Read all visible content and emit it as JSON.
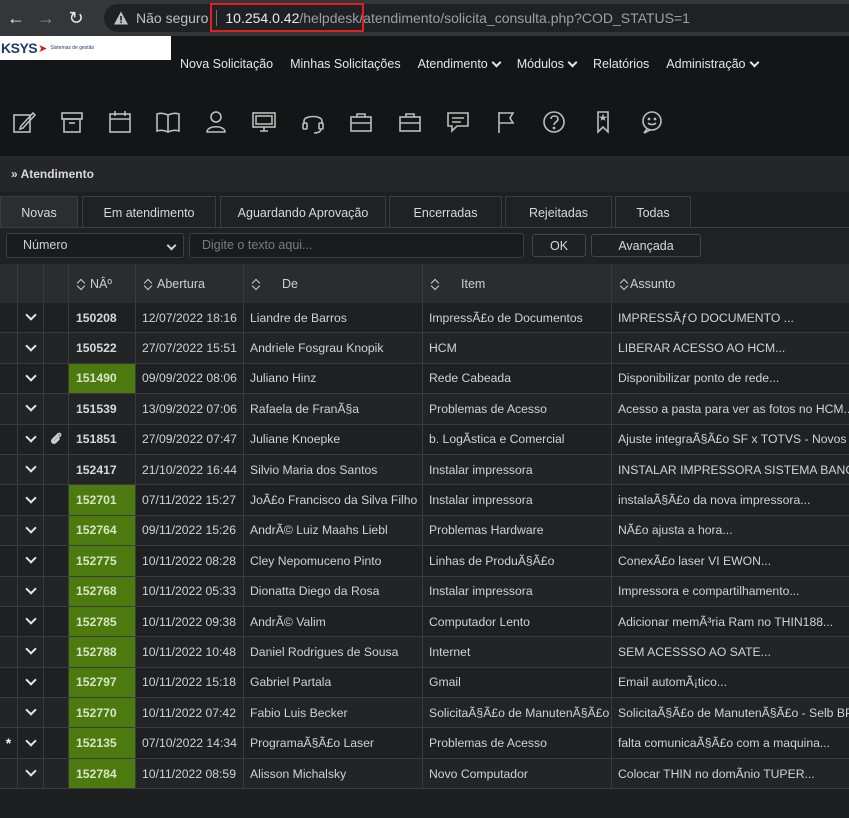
{
  "browser": {
    "not_secure": "Não seguro",
    "url_host": "10.254.0.42",
    "url_path": "/helpdesk/atendimento/solicita_consulta.php?COD_STATUS=1"
  },
  "logo": {
    "text": "KSYS",
    "tagline": "Sistemas de gestão"
  },
  "menu": {
    "items": [
      {
        "label": "Nova Solicitação",
        "dropdown": false
      },
      {
        "label": "Minhas Solicitações",
        "dropdown": false
      },
      {
        "label": "Atendimento",
        "dropdown": true
      },
      {
        "label": "Módulos",
        "dropdown": true
      },
      {
        "label": "Relatórios",
        "dropdown": false
      },
      {
        "label": "Administração",
        "dropdown": true
      }
    ]
  },
  "toolbar_icons": [
    "edit-icon",
    "archive-icon",
    "calendar-icon",
    "book-icon",
    "user-icon",
    "monitor-icon",
    "headset-icon",
    "briefcase-icon",
    "briefcase-icon",
    "chat-icon",
    "flag-icon",
    "help-icon",
    "bookmark-icon",
    "smile-chat-icon"
  ],
  "breadcrumb": "» Atendimento",
  "tabs": [
    {
      "label": "Novas",
      "active": true
    },
    {
      "label": "Em atendimento",
      "active": false
    },
    {
      "label": "Aguardando Aprovação",
      "active": false
    },
    {
      "label": "Encerradas",
      "active": false
    },
    {
      "label": "Rejeitadas",
      "active": false
    },
    {
      "label": "Todas",
      "active": false
    }
  ],
  "filters": {
    "field_select": "Número",
    "search_placeholder": "Digite o texto aqui...",
    "ok_label": "OK",
    "advanced_label": "Avançada"
  },
  "table": {
    "columns": [
      "NÂº",
      "Abertura",
      "De",
      "Item",
      "Assunto"
    ],
    "rows": [
      {
        "marker": "",
        "clip": false,
        "num": "150208",
        "green": false,
        "date": "12/07/2022 18:16",
        "from": "Liandre de Barros",
        "item": "ImpressÃ£o de Documentos",
        "subject": "IMPRESSÃƒO DOCUMENTO ..."
      },
      {
        "marker": "",
        "clip": false,
        "num": "150522",
        "green": false,
        "date": "27/07/2022 15:51",
        "from": "Andriele Fosgrau Knopik",
        "item": "HCM",
        "subject": "LIBERAR ACESSO AO HCM..."
      },
      {
        "marker": "",
        "clip": false,
        "num": "151490",
        "green": true,
        "date": "09/09/2022 08:06",
        "from": "Juliano Hinz",
        "item": "Rede Cabeada",
        "subject": "Disponibilizar ponto de rede..."
      },
      {
        "marker": "",
        "clip": false,
        "num": "151539",
        "green": false,
        "date": "13/09/2022 07:06",
        "from": "Rafaela de FranÃ§a",
        "item": "Problemas de Acesso",
        "subject": "Acesso a pasta para ver as fotos no HCM..."
      },
      {
        "marker": "",
        "clip": true,
        "num": "151851",
        "green": false,
        "date": "27/09/2022 07:47",
        "from": "Juliane Knoepke",
        "item": "b. LogÃ­stica e Comercial",
        "subject": "Ajuste integraÃ§Ã£o SF x TOTVS - Novos c"
      },
      {
        "marker": "",
        "clip": false,
        "num": "152417",
        "green": false,
        "date": "21/10/2022 16:44",
        "from": "Silvio Maria dos Santos",
        "item": "Instalar impressora",
        "subject": "INSTALAR IMPRESSORA SISTEMA BANCO"
      },
      {
        "marker": "",
        "clip": false,
        "num": "152701",
        "green": true,
        "date": "07/11/2022 15:27",
        "from": "JoÃ£o Francisco da Silva Filho",
        "item": "Instalar impressora",
        "subject": "instalaÃ§Ã£o da nova impressora..."
      },
      {
        "marker": "",
        "clip": false,
        "num": "152764",
        "green": true,
        "date": "09/11/2022 15:26",
        "from": "AndrÃ© Luiz Maahs Liebl",
        "item": "Problemas Hardware",
        "subject": "NÃ£o ajusta a hora..."
      },
      {
        "marker": "",
        "clip": false,
        "num": "152775",
        "green": true,
        "date": "10/11/2022 08:28",
        "from": "Cley Nepomuceno Pinto",
        "item": "Linhas de ProduÃ§Ã£o",
        "subject": "ConexÃ£o laser VI EWON..."
      },
      {
        "marker": "",
        "clip": false,
        "num": "152768",
        "green": true,
        "date": "10/11/2022 05:33",
        "from": "Dionatta Diego da Rosa",
        "item": "Instalar impressora",
        "subject": "Impressora e compartilhamento..."
      },
      {
        "marker": "",
        "clip": false,
        "num": "152785",
        "green": true,
        "date": "10/11/2022 09:38",
        "from": "AndrÃ© Valim",
        "item": "Computador Lento",
        "subject": "Adicionar memÃ³ria Ram no THIN188..."
      },
      {
        "marker": "",
        "clip": false,
        "num": "152788",
        "green": true,
        "date": "10/11/2022 10:48",
        "from": "Daniel Rodrigues de Sousa",
        "item": "Internet",
        "subject": "SEM ACESSSO AO SATE..."
      },
      {
        "marker": "",
        "clip": false,
        "num": "152797",
        "green": true,
        "date": "10/11/2022 15:18",
        "from": "Gabriel Partala",
        "item": "Gmail",
        "subject": "Email automÃ¡tico..."
      },
      {
        "marker": "",
        "clip": false,
        "num": "152770",
        "green": true,
        "date": "10/11/2022 07:42",
        "from": "Fabio Luis Becker",
        "item": "SolicitaÃ§Ã£o de ManutenÃ§Ã£o",
        "subject": "SolicitaÃ§Ã£o de ManutenÃ§Ã£o - Selb BP"
      },
      {
        "marker": "*",
        "clip": false,
        "num": "152135",
        "green": true,
        "date": "07/10/2022 14:34",
        "from": "ProgramaÃ§Ã£o Laser",
        "item": "Problemas de Acesso",
        "subject": "falta comunicaÃ§Ã£o com a maquina..."
      },
      {
        "marker": "",
        "clip": false,
        "num": "152784",
        "green": true,
        "date": "10/11/2022 08:59",
        "from": "Alisson Michalsky",
        "item": "Novo Computador",
        "subject": "Colocar THIN no domÃ­nio TUPER..."
      }
    ]
  },
  "colors": {
    "new_status_green": "#4d7a0e",
    "url_highlight": "#e02020"
  }
}
